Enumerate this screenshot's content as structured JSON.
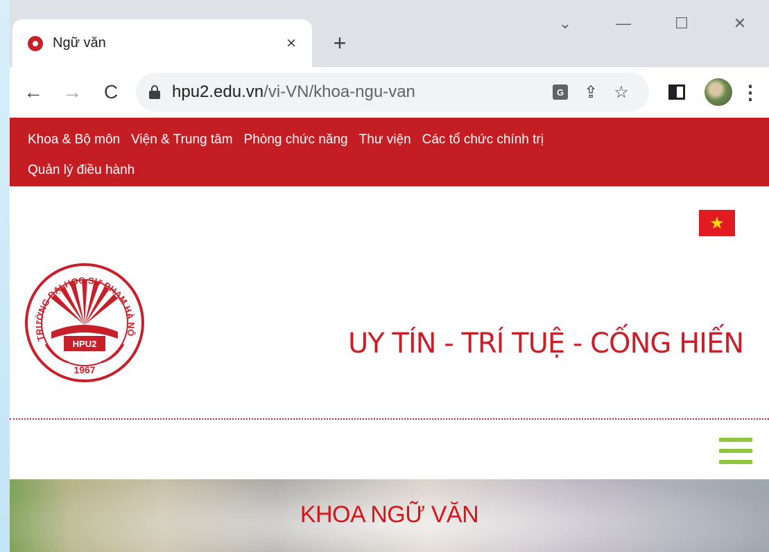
{
  "browser": {
    "tab": {
      "title": "Ngữ văn",
      "close_glyph": "×"
    },
    "new_tab_glyph": "+",
    "window_controls": [
      "⌄",
      "—",
      "☐",
      "✕"
    ],
    "nav": {
      "back": "←",
      "forward": "→",
      "reload": "C"
    },
    "address": {
      "host": "hpu2.edu.vn",
      "path": "/vi-VN/khoa-ngu-van"
    },
    "toolbar_icons": [
      "translate-icon",
      "share-icon",
      "star-icon",
      "side-panel-icon",
      "profile-avatar",
      "kebab-menu-icon"
    ],
    "translate_label": "G",
    "share_glyph": "⇪",
    "star_glyph": "☆",
    "kebab_glyph": "⋮"
  },
  "site_nav": {
    "row1": [
      "Khoa & Bộ môn",
      "Viện & Trung tâm",
      "Phòng chức năng",
      "Thư viện",
      "Các tổ chức chính trị"
    ],
    "row2": [
      "Quản lý điều hành"
    ]
  },
  "header": {
    "logo": {
      "ring_text": "TRƯỜNG ĐẠI HỌC SƯ PHẠM HÀ NỘI 2",
      "center_text": "HPU2",
      "year": "1967"
    },
    "slogan": "UY TÍN - TRÍ TUỆ - CỐNG HIẾN",
    "flag_glyph": "★"
  },
  "banner": {
    "title": "KHOA NGỮ VĂN"
  },
  "colors": {
    "brand_red": "#c41e24",
    "slogan_red": "#c8202a",
    "hamburger_green": "#8ec63f",
    "chrome_tabstrip": "#dee1e6"
  }
}
